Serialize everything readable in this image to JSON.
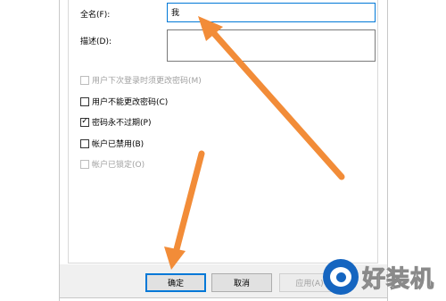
{
  "form": {
    "fullname_label": "全名(F):",
    "fullname_value": "我",
    "description_label": "描述(D):",
    "description_value": ""
  },
  "checkboxes": [
    {
      "label": "用户下次登录时须更改密码(M)",
      "checked": false,
      "enabled": false,
      "mark": ""
    },
    {
      "label": "用户不能更改密码(C)",
      "checked": false,
      "enabled": true,
      "mark": ""
    },
    {
      "label": "密码永不过期(P)",
      "checked": true,
      "enabled": true,
      "mark": "✓"
    },
    {
      "label": "帐户已禁用(B)",
      "checked": false,
      "enabled": true,
      "mark": ""
    },
    {
      "label": "帐户已锁定(O)",
      "checked": false,
      "enabled": false,
      "mark": ""
    }
  ],
  "buttons": {
    "ok": "确定",
    "cancel": "取消",
    "apply": "应用(A)"
  },
  "watermark": {
    "text": "好装机",
    "icon": "eye-logo-icon"
  },
  "annotations": {
    "arrow_color": "#f28c38"
  }
}
